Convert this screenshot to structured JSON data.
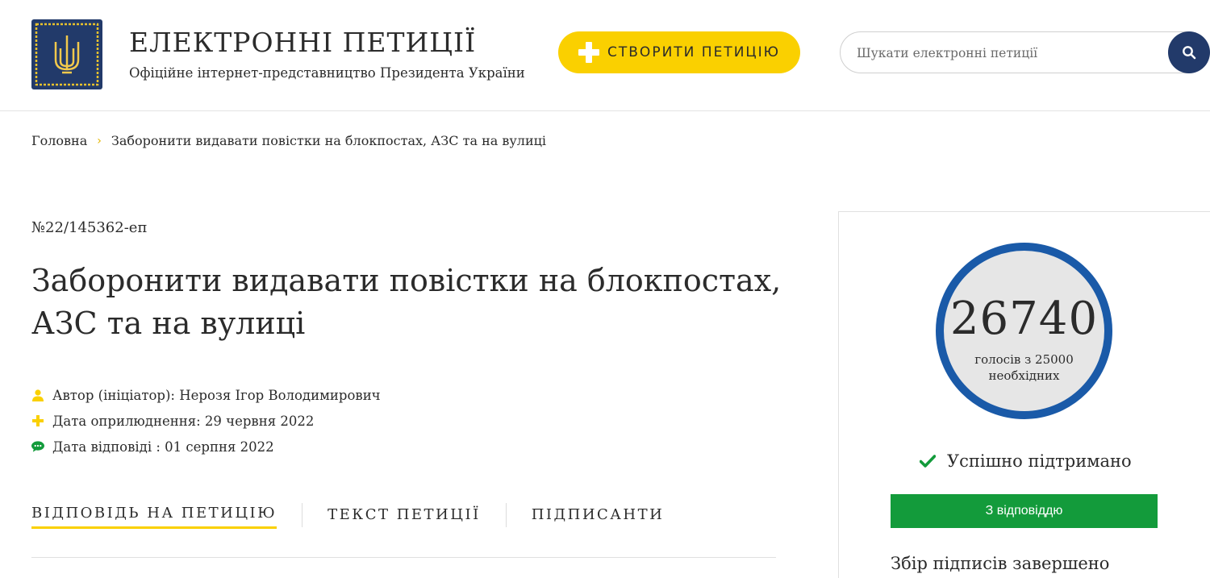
{
  "header": {
    "site_title": "ЕЛЕКТРОННІ ПЕТИЦІЇ",
    "site_subtitle": "Офіційне інтернет-представництво Президента України",
    "create_button_label": "СТВОРИТИ ПЕТИЦІЮ",
    "search_placeholder": "Шукати електронні петиції",
    "logo_icon": "trident-coat-of-arms-icon",
    "colors": {
      "brand_navy": "#223a6a",
      "accent_yellow": "#fad000"
    }
  },
  "breadcrumb": {
    "home": "Головна",
    "separator": "›",
    "current": "Заборонити видавати повістки на блокпостах, АЗС та на вулиці"
  },
  "petition": {
    "number": "№22/145362-еп",
    "title": "Заборонити видавати повістки на блокпостах, АЗС та на вулиці",
    "meta": [
      {
        "icon": "user-icon",
        "text": "Автор (ініціатор): Нерозя Ігор Володимирович"
      },
      {
        "icon": "plus-icon",
        "text": "Дата оприлюднення: 29 червня 2022"
      },
      {
        "icon": "chat-bubble-icon",
        "text": "Дата відповіді : 01 серпня 2022"
      }
    ],
    "tabs": [
      {
        "label": "ВІДПОВІДЬ НА ПЕТИЦІЮ",
        "active": true
      },
      {
        "label": "ТЕКСТ ПЕТИЦІЇ",
        "active": false
      },
      {
        "label": "ПІДПИСАНТИ",
        "active": false
      }
    ]
  },
  "sidebar": {
    "votes": "26740",
    "votes_sub": "голосів з 25000 необхідних",
    "status_text": "Успішно підтримано",
    "answered_button": "З відповіддю",
    "collection_status": "Збір підписів завершено",
    "colors": {
      "circle_border": "#1a5aa8",
      "success_green": "#139b3b"
    }
  }
}
